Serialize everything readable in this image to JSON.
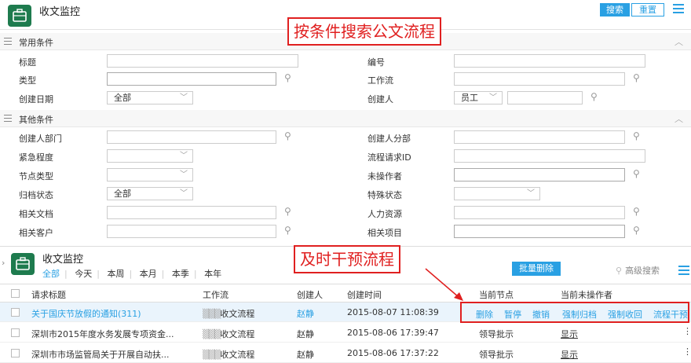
{
  "header": {
    "title": "收文监控",
    "search_label": "搜索",
    "reset_label": "重置"
  },
  "annotations": {
    "search": "按条件搜索公文流程",
    "intervene": "及时干预流程"
  },
  "common": {
    "title": "常用条件",
    "labels": {
      "title": "标题",
      "number": "编号",
      "type": "类型",
      "workflow": "工作流",
      "created_date": "创建日期",
      "creator": "创建人"
    },
    "created_date_value": "全部",
    "creator_type_value": "员工"
  },
  "other": {
    "title": "其他条件",
    "labels": {
      "creator_dept": "创建人部门",
      "creator_subdept": "创建人分部",
      "urgency": "紧急程度",
      "request_id": "流程请求ID",
      "node_type": "节点类型",
      "pending": "未操作者",
      "archive": "归档状态",
      "special": "特殊状态",
      "docs": "相关文档",
      "hr": "人力资源",
      "customer": "相关客户",
      "project": "相关项目"
    },
    "archive_value": "全部"
  },
  "list": {
    "title": "收文监控",
    "filters": [
      "全部",
      "今天",
      "本周",
      "本月",
      "本季",
      "本年"
    ],
    "batch_delete": "批量删除",
    "advanced_search": "高级搜索",
    "columns": [
      "请求标题",
      "工作流",
      "创建人",
      "创建时间",
      "当前节点",
      "当前未操作者"
    ],
    "rows": [
      {
        "title": "关于国庆节放假的通知(311)",
        "workflow": "收文流程",
        "creator": "赵静",
        "time": "2015-08-07 11:08:39",
        "node": "",
        "pending": ""
      },
      {
        "title": "深圳市2015年度水务发展专项资金...",
        "workflow": "收文流程",
        "creator": "赵静",
        "time": "2015-08-06 17:39:47",
        "node": "领导批示",
        "pending": "显示"
      },
      {
        "title": "深圳市市场监管局关于开展自动扶...",
        "workflow": "收文流程",
        "creator": "赵静",
        "time": "2015-08-06 17:37:22",
        "node": "领导批示",
        "pending": "显示"
      }
    ],
    "operations": [
      "删除",
      "暂停",
      "撤销",
      "强制归档",
      "强制收回",
      "流程干预"
    ]
  },
  "colors": {
    "accent": "#29a0e3",
    "annotation": "#e02020",
    "logo": "#1e7b4e"
  }
}
